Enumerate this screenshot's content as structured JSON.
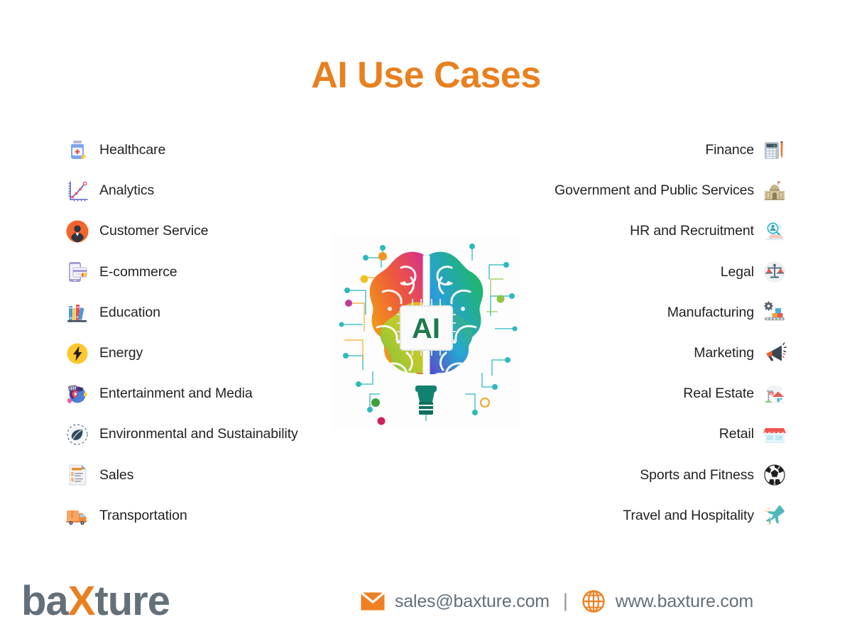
{
  "page": {
    "title": "AI Use Cases",
    "accent_color": "#E8801F",
    "text_color": "#231f20",
    "footer_text_color": "#63707a",
    "background": "#ffffff"
  },
  "center_image": {
    "label": "AI",
    "alt": "colorful gradient brain made of circuitry with an AI chip at its center",
    "icon": "ai-brain-circuit"
  },
  "left_column": [
    {
      "label": "Healthcare",
      "icon": "medicine-bottle-icon"
    },
    {
      "label": "Analytics",
      "icon": "line-chart-icon"
    },
    {
      "label": "Customer Service",
      "icon": "support-agent-icon"
    },
    {
      "label": "E-commerce",
      "icon": "mobile-payment-icon"
    },
    {
      "label": "Education",
      "icon": "books-icon"
    },
    {
      "label": "Energy",
      "icon": "lightning-bolt-icon"
    },
    {
      "label": "Entertainment and Media",
      "icon": "media-collage-icon"
    },
    {
      "label": "Environmental and Sustainability",
      "icon": "leaf-icon"
    },
    {
      "label": "Sales",
      "icon": "invoice-icon"
    },
    {
      "label": "Transportation",
      "icon": "delivery-truck-icon"
    }
  ],
  "right_column": [
    {
      "label": "Finance",
      "icon": "calculator-icon"
    },
    {
      "label": "Government and Public Services",
      "icon": "government-building-icon"
    },
    {
      "label": "HR and Recruitment",
      "icon": "candidate-search-icon"
    },
    {
      "label": "Legal",
      "icon": "scales-of-justice-icon"
    },
    {
      "label": "Manufacturing",
      "icon": "conveyor-belt-icon"
    },
    {
      "label": "Marketing",
      "icon": "megaphone-icon"
    },
    {
      "label": "Real Estate",
      "icon": "house-for-sale-icon"
    },
    {
      "label": "Retail",
      "icon": "storefront-icon"
    },
    {
      "label": "Sports and Fitness",
      "icon": "soccer-ball-icon"
    },
    {
      "label": "Travel and Hospitality",
      "icon": "airplane-icon"
    }
  ],
  "footer": {
    "logo_before": "ba",
    "logo_accent": "X",
    "logo_after": "ture",
    "email": "sales@baxture.com",
    "website": "www.baxture.com",
    "separator": "|",
    "email_icon": "envelope-icon",
    "website_icon": "globe-icon"
  }
}
